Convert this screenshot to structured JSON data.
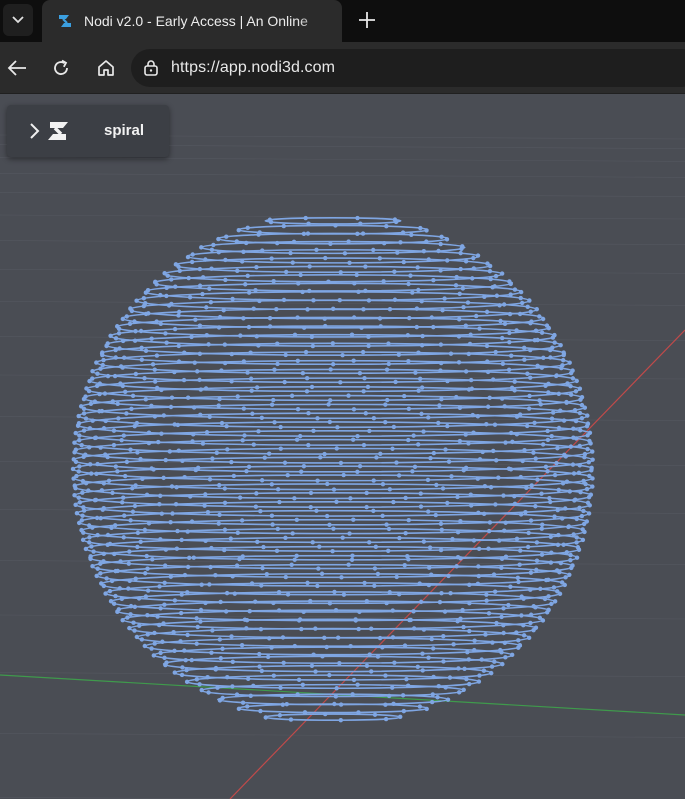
{
  "browser": {
    "tab_title": "Nodi v2.0 - Early Access | An Online",
    "url": "https://app.nodi3d.com",
    "accent": "#3b9fe0"
  },
  "icons": [
    "chevron-down-icon",
    "nodi-favicon-icon",
    "plus-icon",
    "back-arrow-icon",
    "reload-icon",
    "home-icon",
    "site-info-icon",
    "chevron-right-icon",
    "nodi-logo-icon"
  ],
  "panel": {
    "file_name": "spiral"
  },
  "scene": {
    "object": "spiral sphere point/line wireframe",
    "wire_color": "#7fa6e3",
    "x_axis_color": "#c04a4a",
    "y_axis_color": "#3f9a4c",
    "background": "#4a4d54"
  }
}
